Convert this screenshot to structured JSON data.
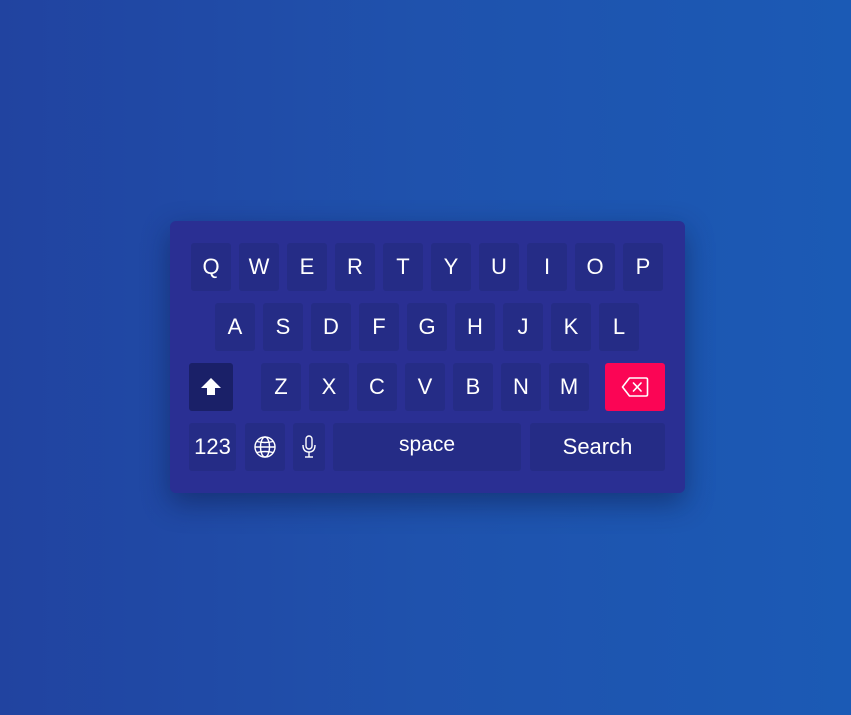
{
  "keyboard": {
    "rows": [
      [
        "Q",
        "W",
        "E",
        "R",
        "T",
        "Y",
        "U",
        "I",
        "O",
        "P"
      ],
      [
        "A",
        "S",
        "D",
        "F",
        "G",
        "H",
        "J",
        "K",
        "L"
      ],
      [
        "Z",
        "X",
        "C",
        "V",
        "B",
        "N",
        "M"
      ]
    ],
    "numbers_label": "123",
    "space_label": "space",
    "search_label": "Search",
    "icons": {
      "shift": "shift-arrow-up-icon",
      "backspace": "backspace-icon",
      "globe": "globe-icon",
      "mic": "microphone-icon"
    },
    "colors": {
      "background_left": "#2143a0",
      "background_right": "#1b5ab5",
      "panel": "#2a2f93",
      "key": "#252c86",
      "shift_key": "#1a2068",
      "backspace_key": "#fb0555",
      "text": "#ffffff"
    }
  }
}
